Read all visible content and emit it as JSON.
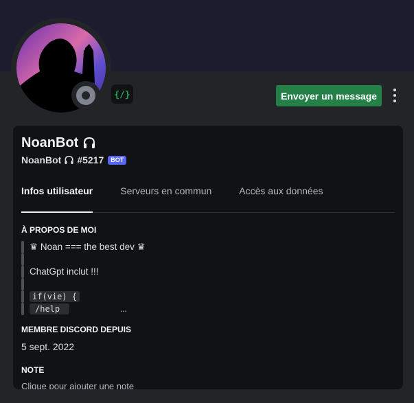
{
  "profile": {
    "display_name": "NoanBot",
    "username": "NoanBot",
    "discriminator": "#5217",
    "bot_tag": "BOT",
    "name_icon": "headphones-icon",
    "status": "offline",
    "badge_icon": "active-developer-icon"
  },
  "actions": {
    "send_message_label": "Envoyer un message",
    "more_icon": "more-vertical-icon"
  },
  "tabs": [
    {
      "label": "Infos utilisateur",
      "active": true
    },
    {
      "label": "Serveurs en commun",
      "active": false
    },
    {
      "label": "Accès aux données",
      "active": false
    }
  ],
  "about": {
    "heading": "À PROPOS DE MOI",
    "line1": "♛ Noan === the best dev ♛",
    "line2": "ChatGpt inclut !!!",
    "code_line": "if(vie) {",
    "command": "/help",
    "ellipsis": "..."
  },
  "member_since": {
    "heading": "MEMBRE DISCORD DEPUIS",
    "date": "5 sept. 2022"
  },
  "note": {
    "heading": "NOTE",
    "placeholder": "Clique pour ajouter une note"
  },
  "colors": {
    "button_green": "#248046",
    "bot_tag": "#5865f2",
    "banner": "#1b1d2f",
    "badge_green": "#23a55a"
  }
}
